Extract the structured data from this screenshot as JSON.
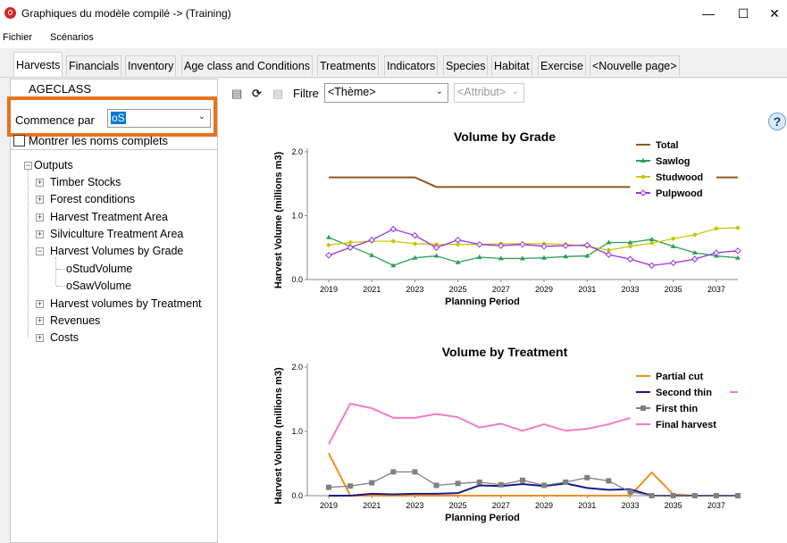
{
  "window": {
    "title": "Graphiques du modèle compilé -> (Training)",
    "minimize": "—",
    "maximize": "☐",
    "close": "✕"
  },
  "menu": [
    "Fichier",
    "Scénarios"
  ],
  "tabs": [
    "Harvests",
    "Financials",
    "Inventory",
    "Age class and Conditions",
    "Treatments",
    "Indicators",
    "Species",
    "Habitat",
    "Exercise",
    "<Nouvelle page>"
  ],
  "left": {
    "heading": "AGECLASS",
    "commence_label": "Commence par",
    "commence_value": "oS",
    "show_full_names": "Montrer les noms complets",
    "tree": {
      "root": "Outputs",
      "items": [
        "Timber Stocks",
        "Forest conditions",
        "Harvest Treatment Area",
        "Silviculture Treatment Area",
        "Harvest Volumes by Grade",
        "Harvest volumes by Treatment",
        "Revenues",
        "Costs"
      ],
      "children": [
        "oStudVolume",
        "oSawVolume"
      ]
    }
  },
  "toolbar": {
    "filter_label": "Filtre",
    "theme": "<Thème>",
    "attribute": "<Attribut>",
    "help": "?"
  },
  "colors": {
    "total": "#8b5a1f",
    "sawlog": "#2ca05a",
    "studwood": "#c8c80a",
    "pulpwood": "#9b30e8",
    "partial": "#f58c1e",
    "second": "#1a1a8c",
    "first": "#808080",
    "final": "#f47ac8",
    "highlight": "#e9711c"
  },
  "chart_data": [
    {
      "type": "line",
      "title": "Volume by Grade",
      "xlabel": "Planning Period",
      "ylabel": "Harvest Volume (millions m3)",
      "ylim": [
        0,
        2.0
      ],
      "yticks": [
        "0.0",
        "1.0",
        "2.0"
      ],
      "xticks": [
        "2019",
        "2021",
        "2023",
        "2025",
        "2027",
        "2029",
        "2031",
        "2033",
        "2035",
        "2037"
      ],
      "x": [
        2019,
        2020,
        2021,
        2022,
        2023,
        2024,
        2025,
        2026,
        2027,
        2028,
        2029,
        2030,
        2031,
        2032,
        2033,
        2034,
        2035,
        2036,
        2037,
        2038
      ],
      "series": [
        {
          "name": "Total",
          "marker": "none",
          "values": [
            1.6,
            1.6,
            1.6,
            1.6,
            1.6,
            1.45,
            1.45,
            1.45,
            1.45,
            1.45,
            1.45,
            1.45,
            1.45,
            1.45,
            1.45,
            null,
            null,
            null,
            1.6,
            1.6
          ]
        },
        {
          "name": "Sawlog",
          "marker": "triangle",
          "values": [
            0.66,
            0.52,
            0.38,
            0.22,
            0.34,
            0.37,
            0.27,
            0.35,
            0.33,
            0.33,
            0.34,
            0.36,
            0.37,
            0.58,
            0.58,
            0.63,
            0.52,
            0.42,
            0.37,
            0.34
          ]
        },
        {
          "name": "Studwood",
          "marker": "circle",
          "values": [
            0.54,
            0.58,
            0.6,
            0.6,
            0.56,
            0.55,
            0.55,
            0.55,
            0.56,
            0.56,
            0.56,
            0.55,
            0.52,
            0.46,
            0.52,
            0.57,
            0.64,
            0.7,
            0.8,
            0.81
          ]
        },
        {
          "name": "Pulpwood",
          "marker": "diamond",
          "values": [
            0.38,
            0.5,
            0.62,
            0.79,
            0.69,
            0.5,
            0.62,
            0.55,
            0.53,
            0.55,
            0.52,
            0.53,
            0.54,
            0.39,
            0.32,
            0.22,
            0.26,
            0.32,
            0.42,
            0.45
          ]
        }
      ]
    },
    {
      "type": "line",
      "title": "Volume by Treatment",
      "xlabel": "Planning Period",
      "ylabel": "Harvest Volume (millions m3)",
      "ylim": [
        0,
        2.0
      ],
      "yticks": [
        "0.0",
        "1.0",
        "2.0"
      ],
      "xticks": [
        "2019",
        "2021",
        "2023",
        "2025",
        "2027",
        "2029",
        "2031",
        "2033",
        "2035",
        "2037"
      ],
      "x": [
        2019,
        2020,
        2021,
        2022,
        2023,
        2024,
        2025,
        2026,
        2027,
        2028,
        2029,
        2030,
        2031,
        2032,
        2033,
        2034,
        2035,
        2036,
        2037,
        2038
      ],
      "series": [
        {
          "name": "Partial cut",
          "marker": "none",
          "values": [
            0.66,
            0.0,
            0.0,
            0.0,
            0.0,
            0.0,
            0.0,
            0.0,
            0.0,
            0.0,
            0.0,
            0.0,
            0.0,
            0.0,
            0.0,
            0.36,
            0.02,
            0.0,
            0.0,
            0.0
          ]
        },
        {
          "name": "Second thin",
          "marker": "none",
          "values": [
            0.0,
            0.0,
            0.03,
            0.02,
            0.03,
            0.03,
            0.04,
            0.16,
            0.15,
            0.18,
            0.15,
            0.19,
            0.12,
            0.09,
            0.1,
            0.0,
            0.0,
            0.0,
            0.0,
            0.0
          ]
        },
        {
          "name": "First thin",
          "marker": "square",
          "values": [
            0.13,
            0.15,
            0.2,
            0.37,
            0.37,
            0.16,
            0.19,
            0.21,
            0.17,
            0.24,
            0.16,
            0.21,
            0.28,
            0.23,
            0.06,
            0.0,
            0.0,
            0.0,
            0.0,
            0.0
          ]
        },
        {
          "name": "Final harvest",
          "marker": "none",
          "values": [
            0.8,
            1.43,
            1.36,
            1.21,
            1.21,
            1.27,
            1.22,
            1.06,
            1.12,
            1.01,
            1.11,
            1.01,
            1.04,
            1.11,
            1.21,
            null,
            null,
            null,
            null,
            null
          ]
        }
      ]
    }
  ]
}
